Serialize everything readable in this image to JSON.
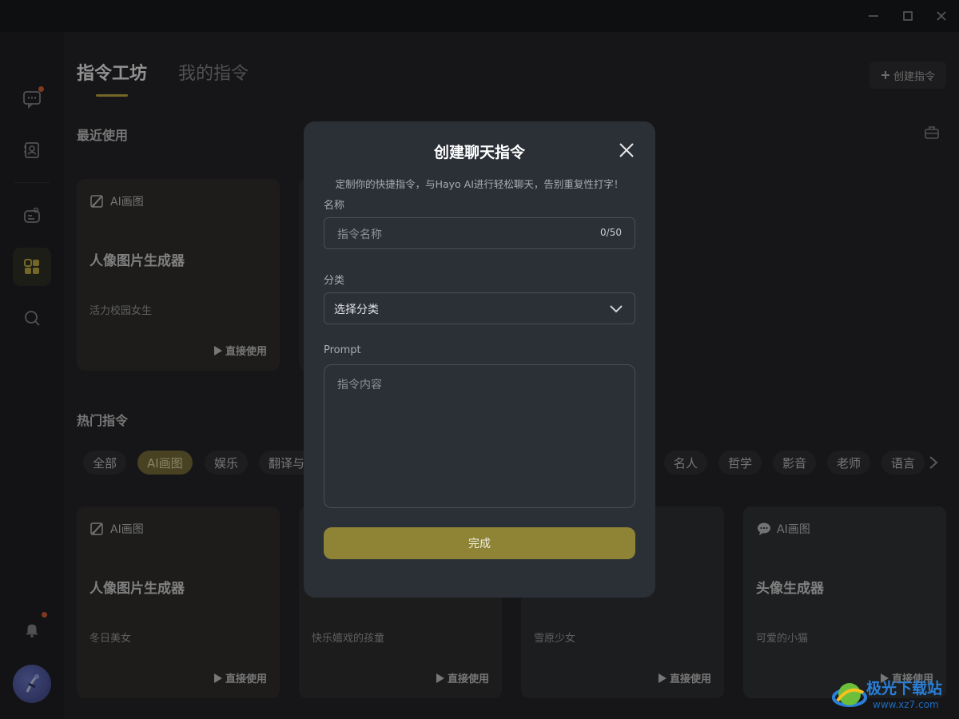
{
  "window": {
    "minimize": "—",
    "maximize": "☐",
    "close": "✕"
  },
  "tabs": [
    {
      "label": "指令工坊",
      "active": true
    },
    {
      "label": "我的指令",
      "active": false
    }
  ],
  "header": {
    "create_label": "创建指令"
  },
  "recent": {
    "title": "最近使用",
    "cards": [
      {
        "category": "AI画图",
        "title": "人像图片生成器",
        "desc": "活力校园女生",
        "use": "直接使用"
      }
    ]
  },
  "hot": {
    "title": "热门指令",
    "chips_left": [
      "全部",
      "AI画图",
      "娱乐",
      "翻译与"
    ],
    "chips_right": [
      "名人",
      "哲学",
      "影音",
      "老师",
      "语言"
    ],
    "active_chip": "AI画图",
    "cards": [
      {
        "category": "AI画图",
        "title": "人像图片生成器",
        "desc": "冬日美女",
        "use": "直接使用"
      },
      {
        "category": "",
        "title": "",
        "desc": "快乐嬉戏的孩童",
        "use": "直接使用"
      },
      {
        "category": "",
        "title": "",
        "desc": "雪原少女",
        "use": "直接使用"
      },
      {
        "category": "AI画图",
        "title": "头像生成器",
        "desc": "可爱的小猫",
        "use": "直接使用"
      }
    ]
  },
  "modal": {
    "title": "创建聊天指令",
    "subtitle": "定制你的快捷指令，与Hayo AI进行轻松聊天，告别重复性打字！",
    "name_label": "名称",
    "name_placeholder": "指令名称",
    "name_counter": "0/50",
    "category_label": "分类",
    "category_value": "选择分类",
    "prompt_label": "Prompt",
    "prompt_placeholder": "指令内容",
    "submit": "完成"
  },
  "watermark": {
    "text": "极光下载站",
    "url": "www.xz7.com"
  },
  "colors": {
    "accent": "#c8b23e",
    "submit": "#8f8336",
    "notify_dot": "#e06030",
    "modal_bg": "#2b2f36"
  }
}
